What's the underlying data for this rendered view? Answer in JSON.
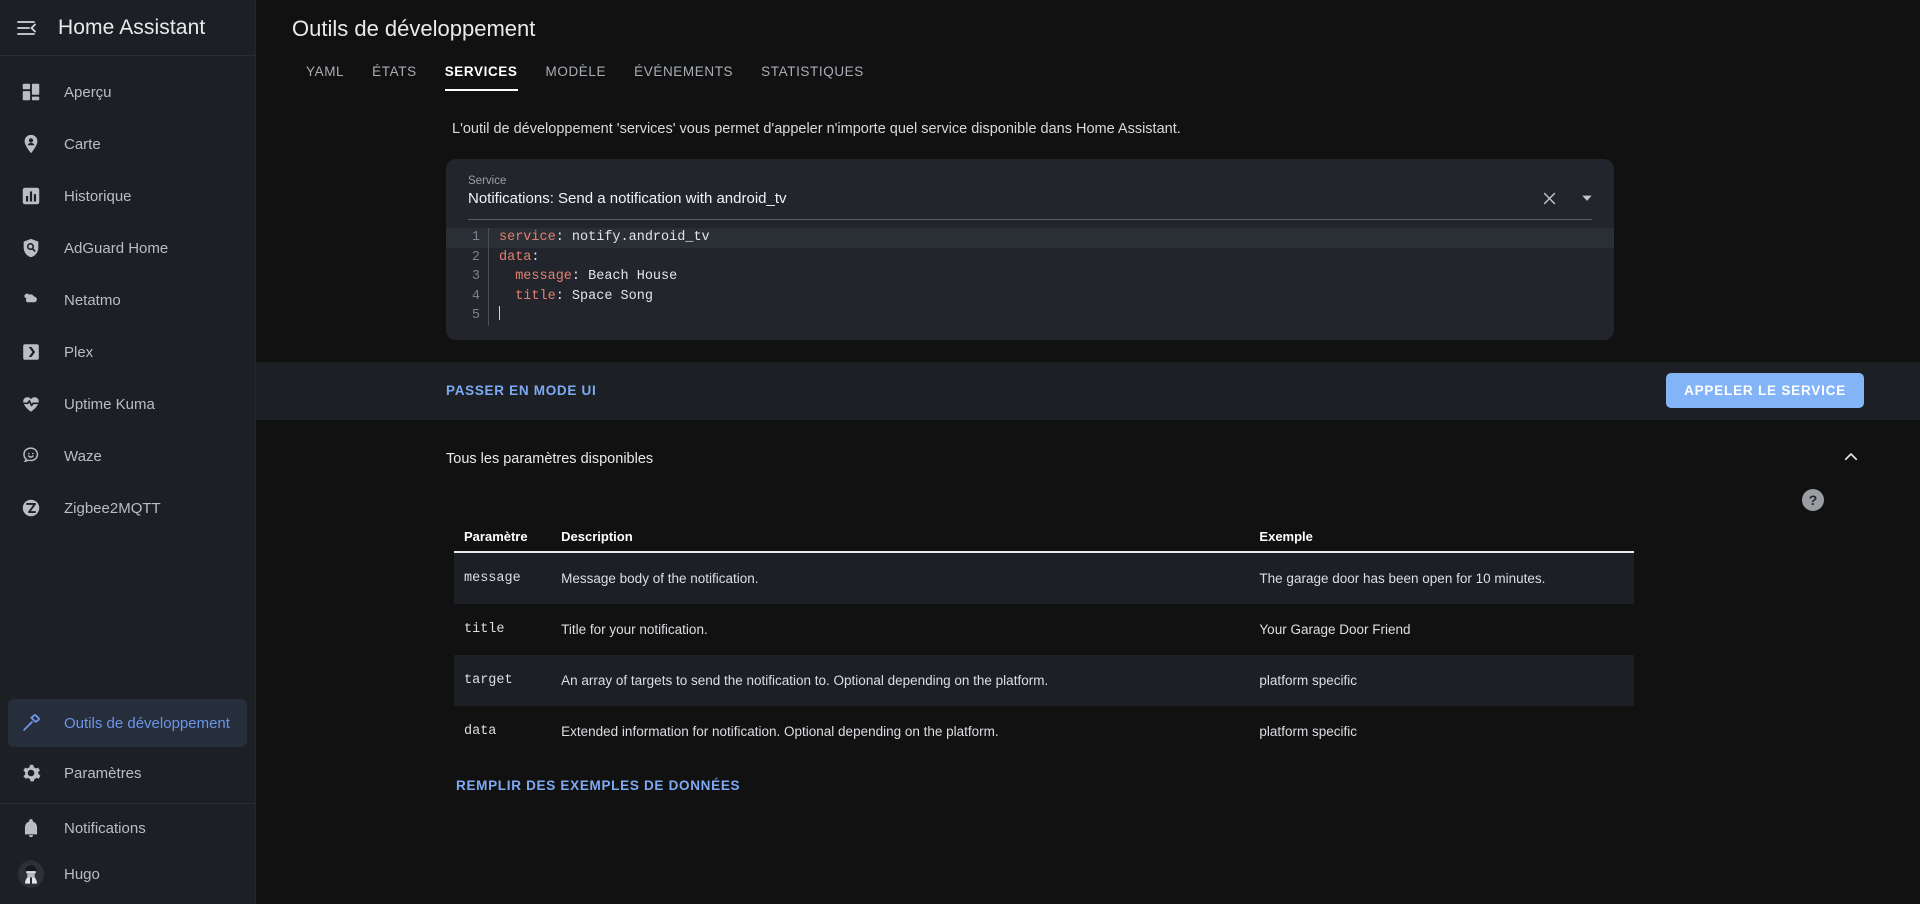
{
  "sidebar": {
    "app_title": "Home Assistant",
    "menu_icon": "menu-collapse-icon",
    "items": [
      {
        "label": "Aperçu",
        "icon": "view-dashboard-icon",
        "active": false
      },
      {
        "label": "Carte",
        "icon": "map-marker-account-icon",
        "active": false
      },
      {
        "label": "Historique",
        "icon": "chart-box-icon",
        "active": false
      },
      {
        "label": "AdGuard Home",
        "icon": "shield-search-icon",
        "active": false
      },
      {
        "label": "Netatmo",
        "icon": "weather-cloud-icon",
        "active": false
      },
      {
        "label": "Plex",
        "icon": "plex-chevron-icon",
        "active": false
      },
      {
        "label": "Uptime Kuma",
        "icon": "heart-pulse-icon",
        "active": false
      },
      {
        "label": "Waze",
        "icon": "waze-smiley-icon",
        "active": false
      },
      {
        "label": "Zigbee2MQTT",
        "icon": "zigbee-z-icon",
        "active": false
      }
    ],
    "bottom_items": [
      {
        "label": "Outils de développement",
        "icon": "hammer-icon",
        "active": true
      },
      {
        "label": "Paramètres",
        "icon": "cog-icon",
        "active": false
      }
    ],
    "footer_items": [
      {
        "label": "Notifications",
        "icon": "bell-icon"
      },
      {
        "label": "Hugo",
        "icon": "user-avatar-icon"
      }
    ]
  },
  "header": {
    "title": "Outils de développement",
    "tabs": [
      {
        "label": "YAML",
        "active": false
      },
      {
        "label": "ÉTATS",
        "active": false
      },
      {
        "label": "SERVICES",
        "active": true
      },
      {
        "label": "MODÈLE",
        "active": false
      },
      {
        "label": "ÉVÉNEMENTS",
        "active": false
      },
      {
        "label": "STATISTIQUES",
        "active": false
      }
    ]
  },
  "main": {
    "intro": "L'outil de développement 'services' vous permet d'appeler n'importe quel service disponible dans Home Assistant.",
    "service_picker": {
      "label": "Service",
      "value": "Notifications: Send a notification with android_tv",
      "clear_icon": "close-icon",
      "dropdown_icon": "chevron-down-icon"
    },
    "editor": {
      "lines": [
        {
          "n": "1",
          "key": "service",
          "rest": ": notify.android_tv",
          "indent": "",
          "highlight": true
        },
        {
          "n": "2",
          "key": "data",
          "rest": ":",
          "indent": "",
          "highlight": false
        },
        {
          "n": "3",
          "key": "message",
          "rest": ": Beach House",
          "indent": "  ",
          "highlight": false
        },
        {
          "n": "4",
          "key": "title",
          "rest": ": Space Song",
          "indent": "  ",
          "highlight": false
        },
        {
          "n": "5",
          "key": "",
          "rest": "",
          "indent": "",
          "highlight": false
        }
      ]
    },
    "actions": {
      "switch_ui_label": "PASSER EN MODE UI",
      "call_service_label": "APPELER LE SERVICE"
    },
    "params_section": {
      "title": "Tous les paramètres disponibles",
      "collapse_icon": "chevron-up-icon",
      "help_icon": "help-circle-icon",
      "help_glyph": "?",
      "columns": [
        "Paramètre",
        "Description",
        "Exemple"
      ],
      "rows": [
        {
          "param": "message",
          "description": "Message body of the notification.",
          "example": "The garage door has been open for 10 minutes.",
          "striped": true
        },
        {
          "param": "title",
          "description": "Title for your notification.",
          "example": "Your Garage Door Friend",
          "striped": false
        },
        {
          "param": "target",
          "description": "An array of targets to send the notification to. Optional depending on the platform.",
          "example": "platform specific",
          "striped": true
        },
        {
          "param": "data",
          "description": "Extended information for notification. Optional depending on the platform.",
          "example": "platform specific",
          "striped": false
        }
      ],
      "fill_example_label": "REMPLIR DES EXEMPLES DE DONNÉES"
    }
  },
  "colors": {
    "accent": "#84b4f8",
    "link": "#7eaaf5",
    "page_bg": "#111111",
    "card_bg": "#22252b",
    "sidebar_bg": "#1c1f24",
    "yaml_key": "#e2806e"
  }
}
